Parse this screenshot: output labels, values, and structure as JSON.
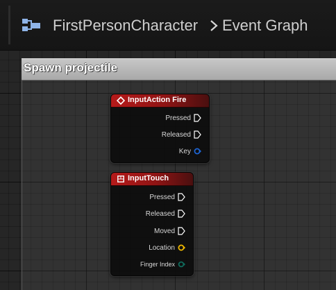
{
  "breadcrumb": {
    "blueprint": "FirstPersonCharacter",
    "graph": "Event Graph"
  },
  "comment": {
    "title": "Spawn projectile"
  },
  "nodes": {
    "input_action_fire": {
      "title": "InputAction Fire",
      "header_icon": "diamond-event-icon",
      "pins": [
        {
          "label": "Pressed",
          "type": "exec"
        },
        {
          "label": "Released",
          "type": "exec"
        },
        {
          "label": "Key",
          "type": "struct"
        }
      ]
    },
    "input_touch": {
      "title": "InputTouch",
      "header_icon": "touch-event-icon",
      "pins": [
        {
          "label": "Pressed",
          "type": "exec"
        },
        {
          "label": "Released",
          "type": "exec"
        },
        {
          "label": "Moved",
          "type": "exec"
        },
        {
          "label": "Location",
          "type": "vector"
        },
        {
          "label": "Finger Index",
          "type": "enum"
        }
      ]
    }
  },
  "colors": {
    "node_header_red": "#b51a1a",
    "pin_struct_blue": "#1e66d6",
    "pin_vector_yellow": "#f0b800",
    "pin_enum_teal": "#0f6b5c",
    "comment_gray": "#b8b8b8",
    "blueprint_icon": "#8fb4e8"
  }
}
